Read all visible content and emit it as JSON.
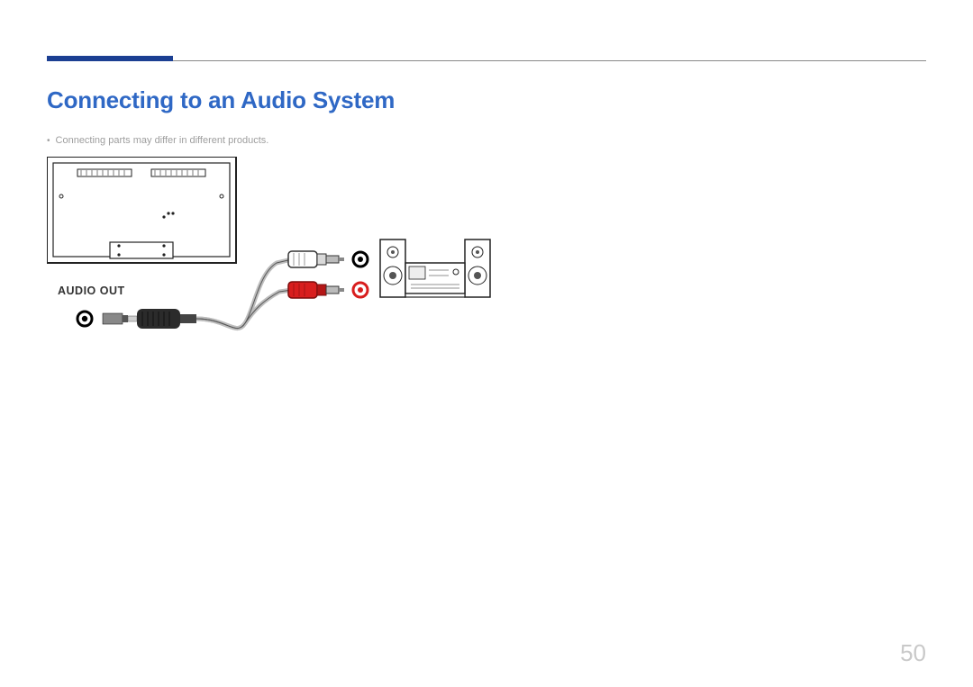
{
  "page": {
    "title": "Connecting to an Audio System",
    "note": "Connecting parts may differ in different products.",
    "port_label": "AUDIO OUT",
    "page_number": "50"
  },
  "colors": {
    "accent": "#1b3f92",
    "title": "#2f68c5",
    "note": "#9e9e9e",
    "page_num": "#c9c9c9",
    "rca_white": "#ffffff",
    "rca_red": "#d81e1e"
  }
}
